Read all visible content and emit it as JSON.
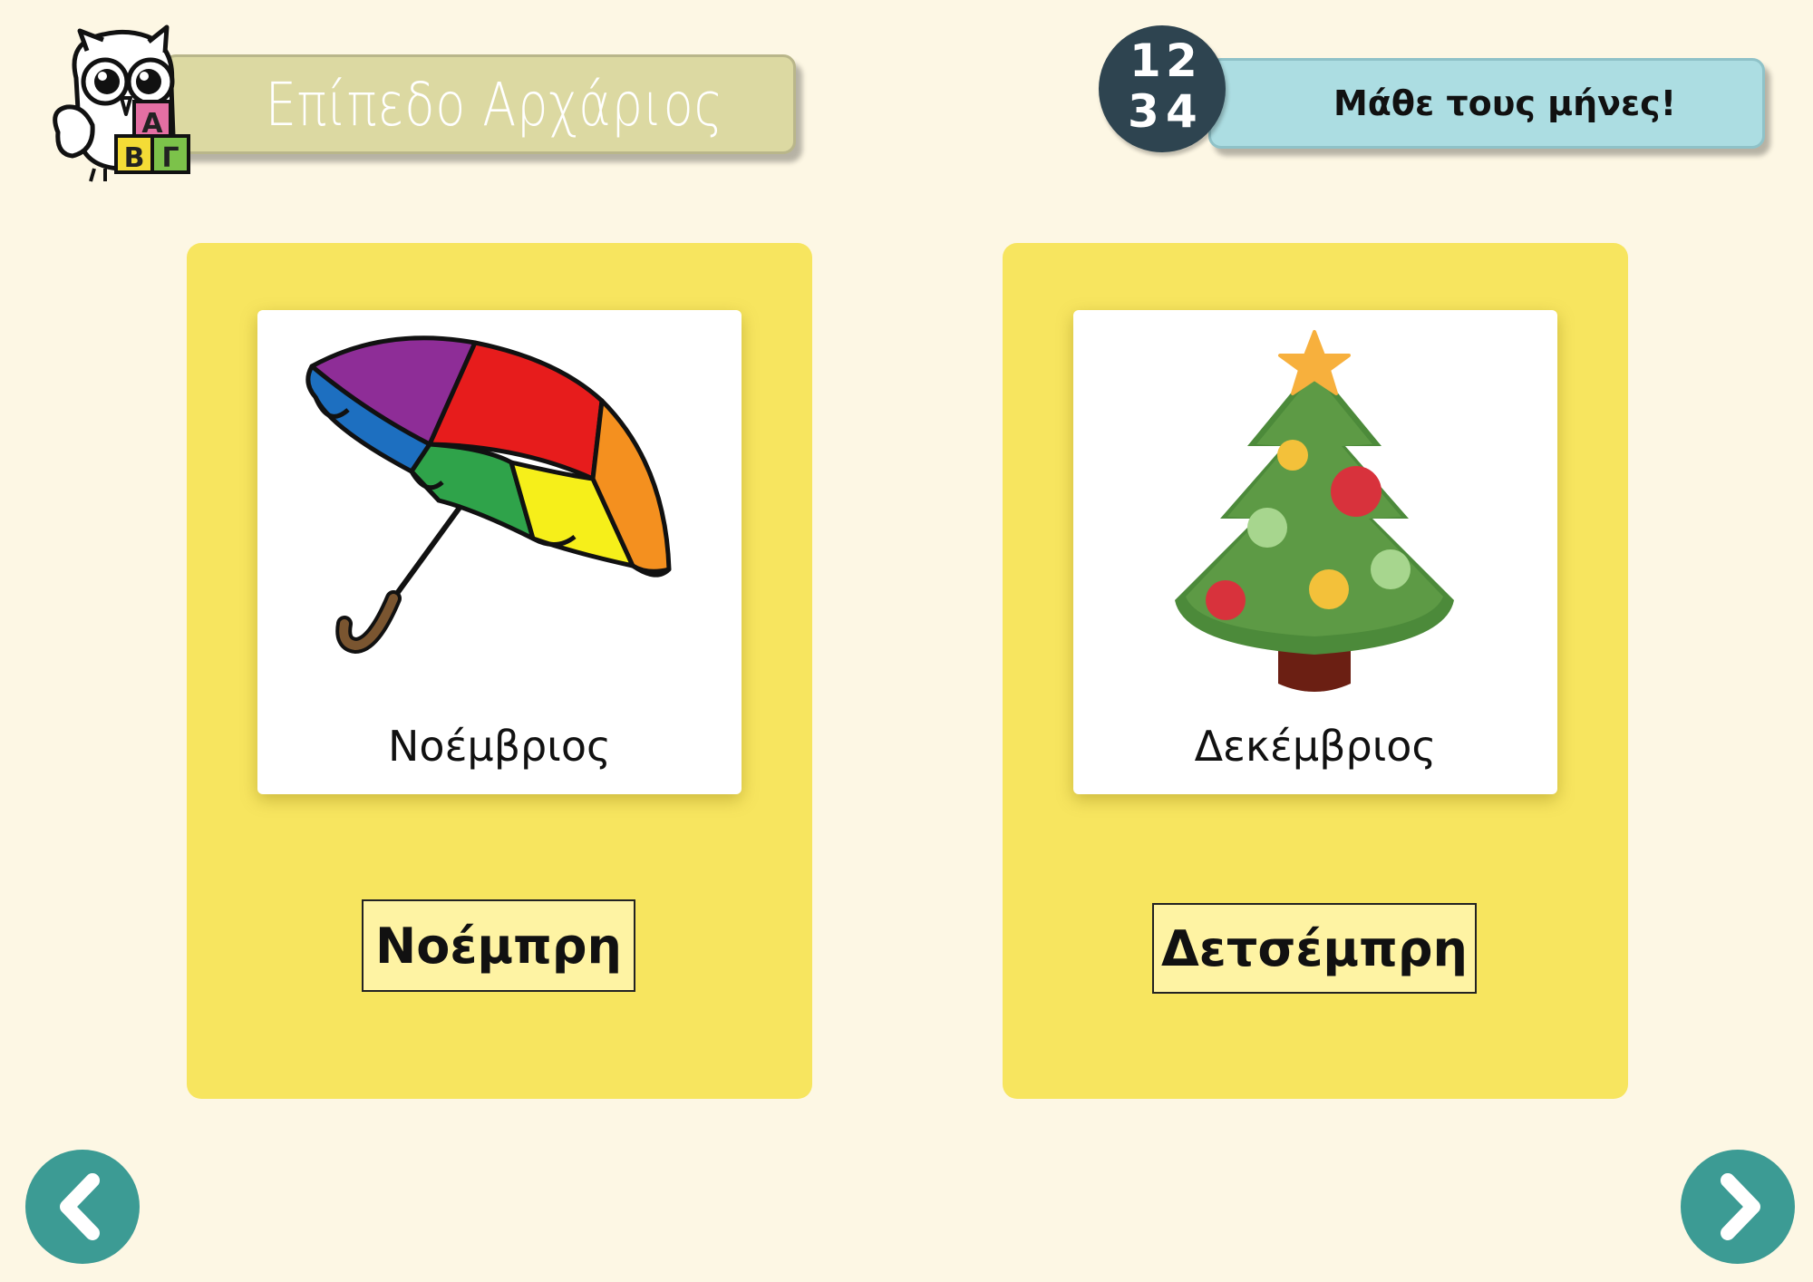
{
  "header": {
    "level_title": "Επίπεδο Αρχάριος",
    "logo_letters": [
      "Α",
      "Β",
      "Γ"
    ],
    "topic_title": "Μάθε τους μήνες!",
    "badge_numbers": [
      "1",
      "2",
      "3",
      "4"
    ]
  },
  "cards": [
    {
      "picture": "umbrella-icon",
      "month_label": "Νοέμβριος",
      "phonetic": "Νοέμπρη"
    },
    {
      "picture": "christmas-tree-icon",
      "month_label": "Δεκέμβριος",
      "phonetic": "Δετσέμπρη"
    }
  ],
  "navigation": {
    "prev": "chevron-left-icon",
    "next": "chevron-right-icon"
  },
  "colors": {
    "background": "#fdf7e4",
    "card": "#f7e55f",
    "level_banner": "#dcd9a2",
    "topic_banner": "#acdde2",
    "nav_button": "#3c9b94",
    "badge": "#2e4450"
  }
}
